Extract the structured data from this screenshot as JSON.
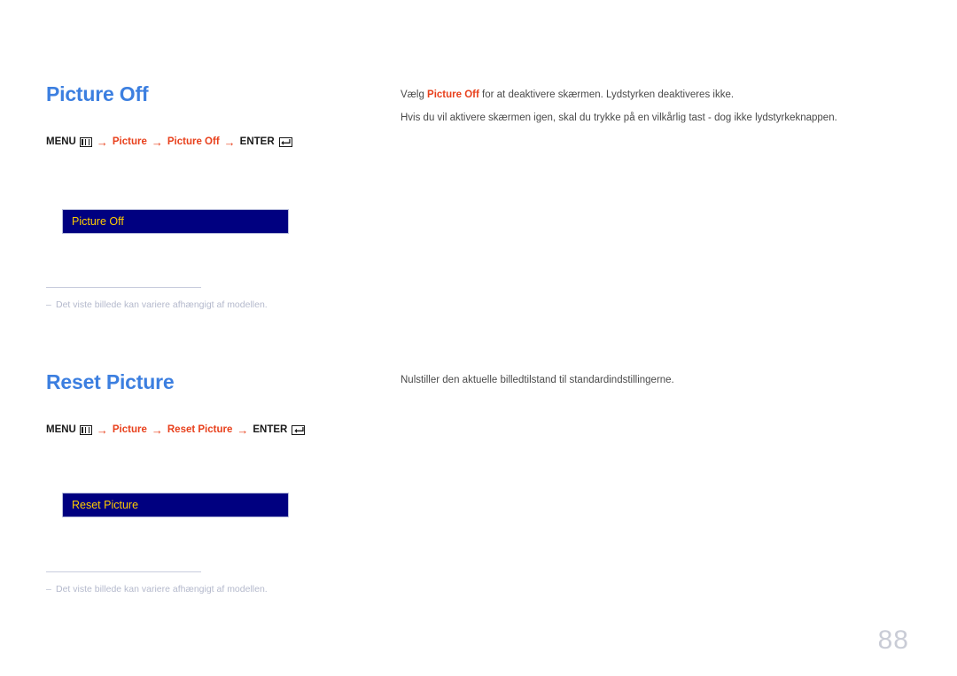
{
  "page": {
    "number": "88",
    "language": "da",
    "colors": {
      "heading_blue": "#3c7fe0",
      "accent_red": "#e8401c",
      "osd_background": "#000080",
      "osd_text": "#ffcc00",
      "osd_border": "#b9bedd",
      "body_text": "#4a4a4a",
      "footnote_gray": "#b4b9cc",
      "page_number_gray": "#c9ccd6",
      "background": "#ffffff"
    }
  },
  "sections": [
    {
      "heading": "Picture Off",
      "path": {
        "menu_label": "MENU",
        "menu_icon": "menu-bars-icon",
        "arrow": "→",
        "crumb_1": "Picture",
        "crumb_2": "Picture Off",
        "enter_label": "ENTER",
        "enter_icon": "enter-return-icon"
      },
      "osd": {
        "label": "Picture Off"
      },
      "footnote": {
        "dash": "–",
        "text": "Det viste billede kan variere afhængigt af modellen."
      },
      "description": {
        "line1_before": "Vælg ",
        "line1_accent": "Picture Off",
        "line1_after": " for at deaktivere skærmen. Lydstyrken deaktiveres ikke.",
        "line2": "Hvis du vil aktivere skærmen igen, skal du trykke på en vilkårlig tast - dog ikke lydstyrkeknappen."
      }
    },
    {
      "heading": "Reset Picture",
      "path": {
        "menu_label": "MENU",
        "menu_icon": "menu-bars-icon",
        "arrow": "→",
        "crumb_1": "Picture",
        "crumb_2": "Reset Picture",
        "enter_label": "ENTER",
        "enter_icon": "enter-return-icon"
      },
      "osd": {
        "label": "Reset Picture"
      },
      "footnote": {
        "dash": "–",
        "text": "Det viste billede kan variere afhængigt af modellen."
      },
      "description": {
        "line1": "Nulstiller den aktuelle billedtilstand til standardindstillingerne."
      }
    }
  ]
}
